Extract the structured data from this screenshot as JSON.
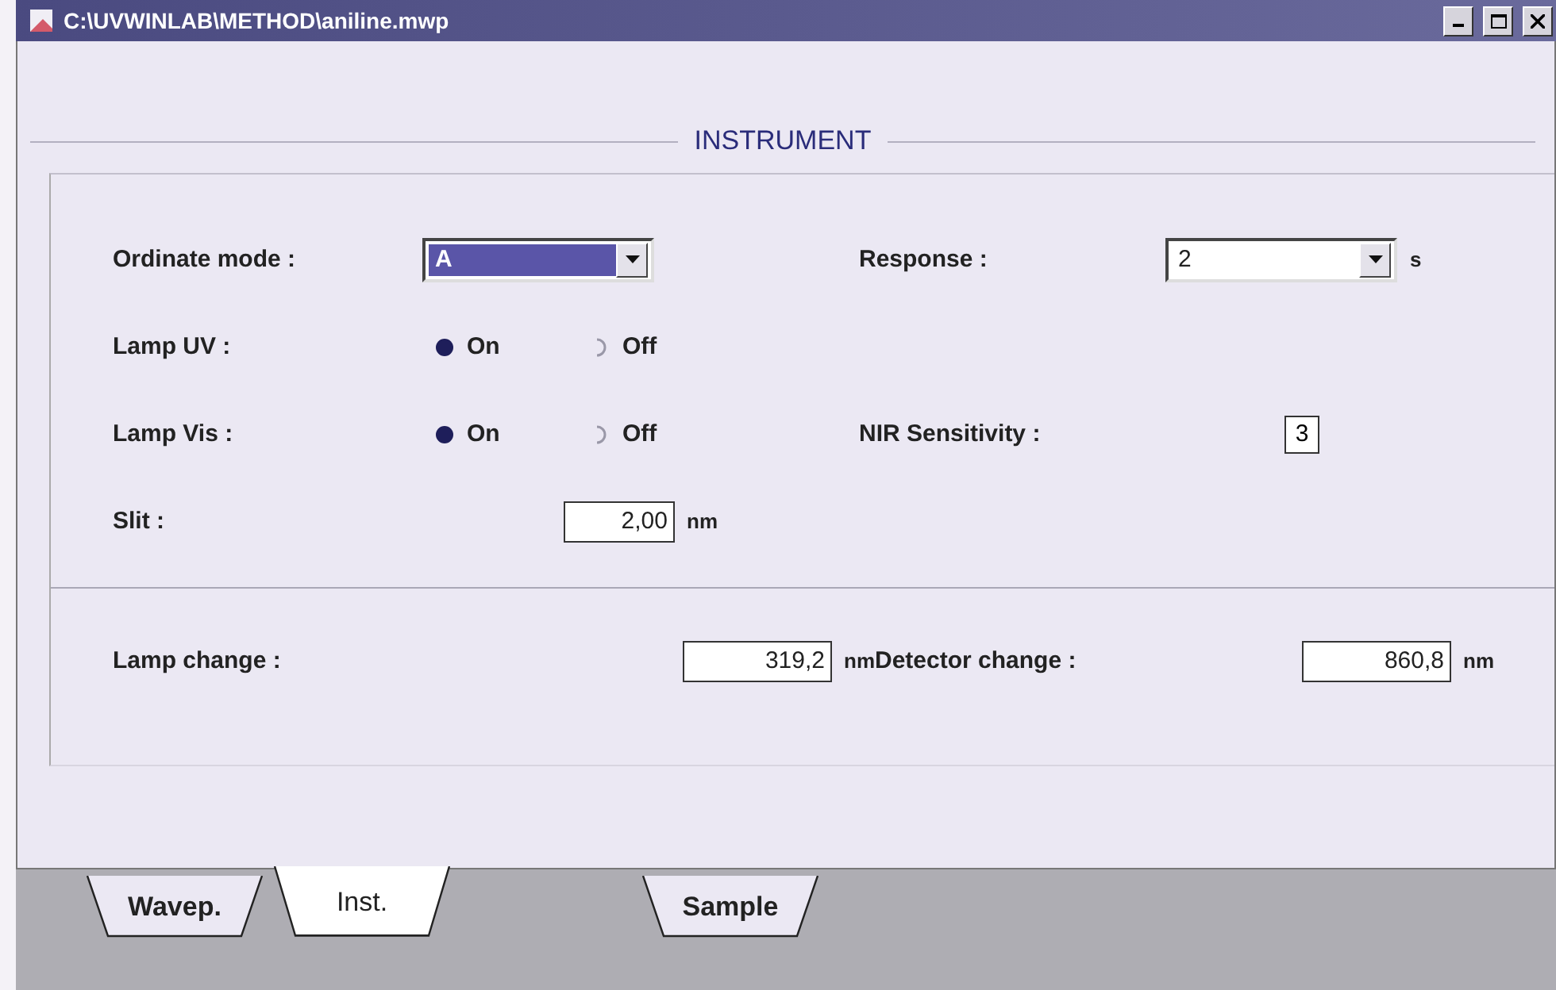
{
  "window": {
    "title": "C:\\UVWINLAB\\METHOD\\aniline.mwp"
  },
  "section": {
    "title": "INSTRUMENT"
  },
  "upper_rows": [
    {
      "left": {
        "label": "Ordinate mode :",
        "kind": "select",
        "value": "A",
        "highlighted": true
      },
      "right": {
        "label": "Response :",
        "kind": "select",
        "value": "2",
        "highlighted": false,
        "unit": "s"
      }
    },
    {
      "left": {
        "label": "Lamp UV :",
        "kind": "radio",
        "options": [
          {
            "label": "On",
            "selected": true
          },
          {
            "label": "Off",
            "selected": false
          }
        ]
      }
    },
    {
      "left": {
        "label": "Lamp Vis :",
        "kind": "radio",
        "options": [
          {
            "label": "On",
            "selected": true
          },
          {
            "label": "Off",
            "selected": false
          }
        ]
      },
      "right": {
        "label": "NIR Sensitivity :",
        "kind": "box",
        "value": "3"
      }
    },
    {
      "left": {
        "label": "Slit :",
        "kind": "field",
        "value": "2,00",
        "unit": "nm"
      }
    }
  ],
  "lower_rows": [
    {
      "left": {
        "label": "Lamp change :",
        "kind": "field",
        "value": "319,2",
        "unit": "nm"
      },
      "right": {
        "label": "Detector change :",
        "kind": "field",
        "value": "860,8",
        "unit": "nm"
      }
    }
  ],
  "tabs": [
    {
      "label": "Wavep.",
      "selected": false
    },
    {
      "label": "Inst.",
      "selected": true
    },
    {
      "label": "Sample",
      "selected": false
    }
  ]
}
